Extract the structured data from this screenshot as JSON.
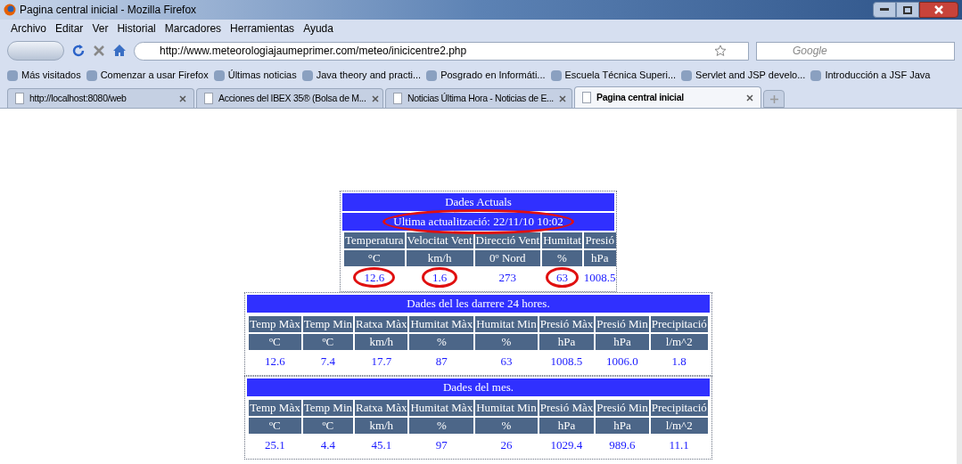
{
  "window": {
    "title": "Pagina central inicial - Mozilla Firefox"
  },
  "menu": [
    "Archivo",
    "Editar",
    "Ver",
    "Historial",
    "Marcadores",
    "Herramientas",
    "Ayuda"
  ],
  "address": {
    "value": "http://www.meteorologiajaumeprimer.com/meteo/inicicentre2.php"
  },
  "search": {
    "placeholder": "Google"
  },
  "bookmarks": [
    "Más visitados",
    "Comenzar a usar Firefox",
    "Últimas noticias",
    "Java theory and practi...",
    "Posgrado en Informáti...",
    "Escuela Técnica Superi...",
    "Servlet and JSP develo...",
    "Introducción a JSF Java"
  ],
  "tabs": [
    {
      "label": "http://localhost:8080/web",
      "selected": false
    },
    {
      "label": "Acciones del IBEX 35® (Bolsa de M...",
      "selected": false
    },
    {
      "label": "Noticias Última Hora - Noticias de E...",
      "selected": false
    },
    {
      "label": "Pagina central inicial",
      "selected": true
    }
  ],
  "current": {
    "title": "Dades Actuals",
    "update": {
      "text": "Ultima actualització: 22/11/10 10:02",
      "circled": true
    },
    "columns": [
      "Temperatura",
      "Velocitat Vent",
      "Direcció Vent",
      "Humitat",
      "Presió"
    ],
    "units": [
      "°C",
      "km/h",
      "0º Nord",
      "%",
      "hPa"
    ],
    "values": [
      {
        "text": "12.6",
        "circled": true
      },
      {
        "text": "1.6",
        "circled": true
      },
      {
        "text": "273",
        "circled": false
      },
      {
        "text": "63",
        "circled": true
      },
      {
        "text": "1008.5",
        "circled": false
      }
    ]
  },
  "summaries": [
    {
      "title": "Dades del les darrere 24 hores.",
      "columns": [
        "Temp Màx",
        "Temp Min",
        "Ratxa Màx",
        "Humitat Màx",
        "Humitat Min",
        "Presió Màx",
        "Presió Min",
        "Precipitació"
      ],
      "units": [
        "ºC",
        "ºC",
        "km/h",
        "%",
        "%",
        "hPa",
        "hPa",
        "l/m^2"
      ],
      "values": [
        "12.6",
        "7.4",
        "17.7",
        "87",
        "63",
        "1008.5",
        "1006.0",
        "1.8"
      ]
    },
    {
      "title": "Dades del mes.",
      "columns": [
        "Temp Màx",
        "Temp Min",
        "Ratxa Màx",
        "Humitat Màx",
        "Humitat Min",
        "Presió Màx",
        "Presió Min",
        "Precipitació"
      ],
      "units": [
        "ºC",
        "ºC",
        "km/h",
        "%",
        "%",
        "hPa",
        "hPa",
        "l/m^2"
      ],
      "values": [
        "25.1",
        "4.4",
        "45.1",
        "97",
        "26",
        "1029.4",
        "989.6",
        "11.1"
      ]
    }
  ]
}
